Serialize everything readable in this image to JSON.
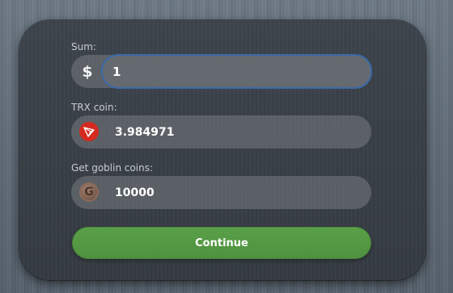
{
  "form": {
    "sum": {
      "label": "Sum:",
      "currency_symbol": "$",
      "value": "1"
    },
    "trx": {
      "label": "TRX coin:",
      "value": "3.984971",
      "icon": "trx-logo-icon"
    },
    "goblin": {
      "label": "Get goblin coins:",
      "value": "10000",
      "icon": "goblin-coin-icon",
      "icon_glyph": "G"
    },
    "continue_label": "Continue"
  },
  "colors": {
    "accent_green": "#54994a",
    "focus_border": "#3a6aa8",
    "trx_red": "#d42a1f"
  }
}
